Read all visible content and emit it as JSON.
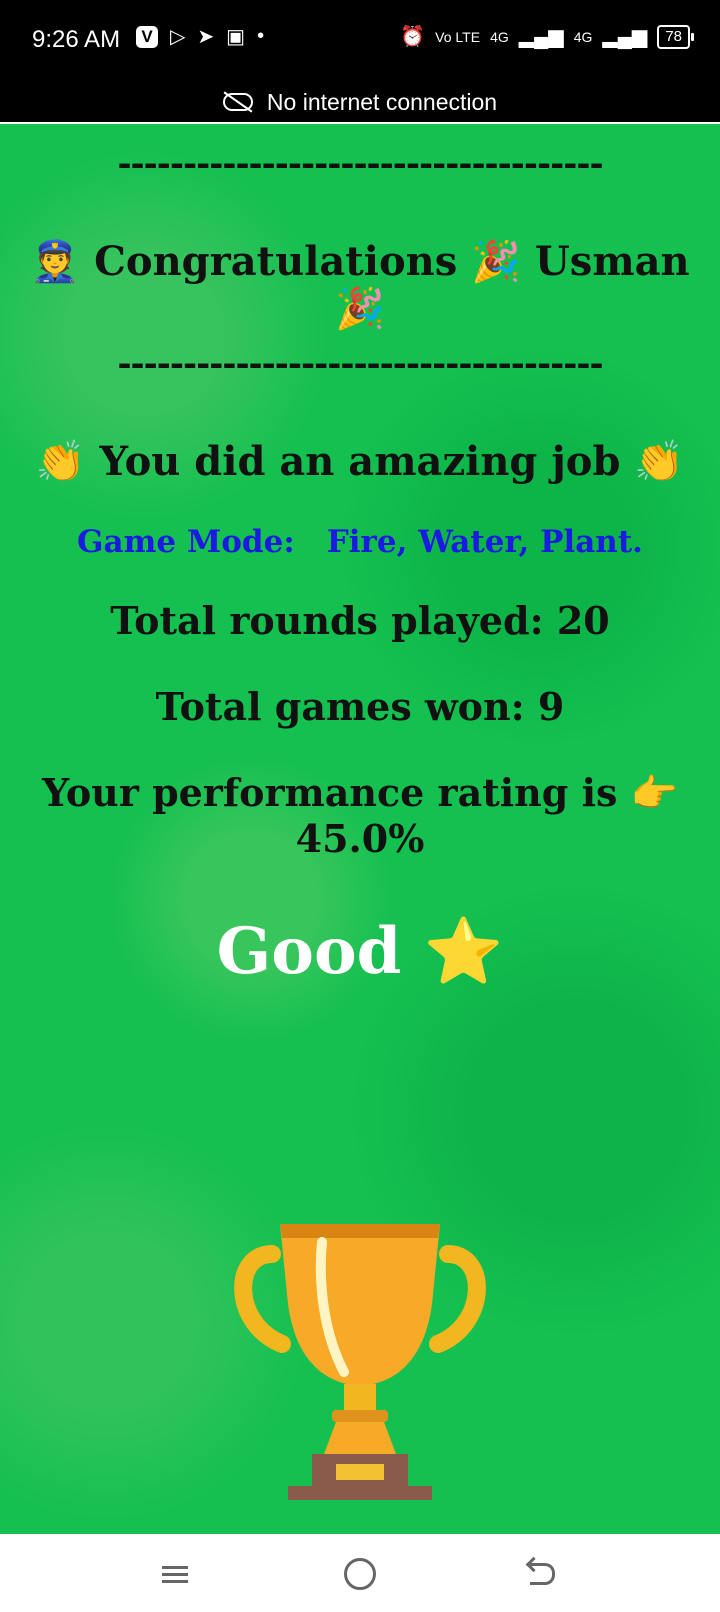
{
  "status_bar": {
    "time": "9:26 AM",
    "app_icon_v": "V",
    "signal_label_1": "4G",
    "signal_label_2": "4G",
    "volte": "Vo LTE",
    "battery": "78"
  },
  "network_banner": {
    "text": "No internet connection",
    "icon": "cloud-off-icon"
  },
  "result": {
    "divider_top": "-------------------------------------",
    "congrats": "👮 Congratulations 🎉 Usman 🎉",
    "divider_bottom": "-------------------------------------",
    "praise": "👏 You did an amazing job 👏",
    "game_mode_label": "Game Mode:",
    "game_mode_value": "Fire, Water, Plant.",
    "rounds_played": "Total rounds played: 20",
    "games_won": "Total games won: 9",
    "rating_line1": "Your performance rating is 👉",
    "rating_line2": "45.0%",
    "grade": "Good ⭐"
  },
  "colors": {
    "background": "#14c050",
    "mode_text": "#1a1ae0"
  },
  "nav_bar": {
    "icons": [
      "menu-icon",
      "home-icon",
      "back-icon"
    ]
  }
}
